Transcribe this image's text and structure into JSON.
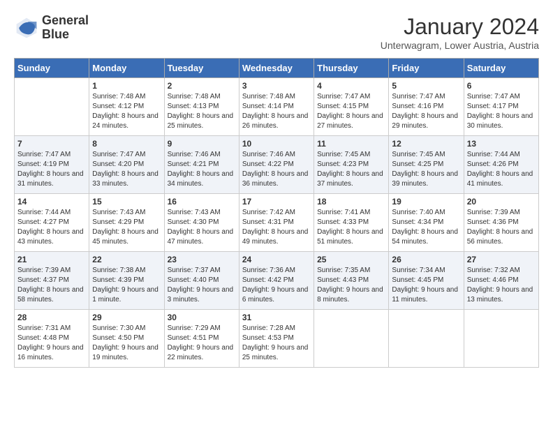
{
  "header": {
    "logo_line1": "General",
    "logo_line2": "Blue",
    "month": "January 2024",
    "location": "Unterwagram, Lower Austria, Austria"
  },
  "days_of_week": [
    "Sunday",
    "Monday",
    "Tuesday",
    "Wednesday",
    "Thursday",
    "Friday",
    "Saturday"
  ],
  "weeks": [
    [
      {
        "day": "",
        "sunrise": "",
        "sunset": "",
        "daylight": ""
      },
      {
        "day": "1",
        "sunrise": "7:48 AM",
        "sunset": "4:12 PM",
        "daylight": "8 hours and 24 minutes."
      },
      {
        "day": "2",
        "sunrise": "7:48 AM",
        "sunset": "4:13 PM",
        "daylight": "8 hours and 25 minutes."
      },
      {
        "day": "3",
        "sunrise": "7:48 AM",
        "sunset": "4:14 PM",
        "daylight": "8 hours and 26 minutes."
      },
      {
        "day": "4",
        "sunrise": "7:47 AM",
        "sunset": "4:15 PM",
        "daylight": "8 hours and 27 minutes."
      },
      {
        "day": "5",
        "sunrise": "7:47 AM",
        "sunset": "4:16 PM",
        "daylight": "8 hours and 29 minutes."
      },
      {
        "day": "6",
        "sunrise": "7:47 AM",
        "sunset": "4:17 PM",
        "daylight": "8 hours and 30 minutes."
      }
    ],
    [
      {
        "day": "7",
        "sunrise": "7:47 AM",
        "sunset": "4:19 PM",
        "daylight": "8 hours and 31 minutes."
      },
      {
        "day": "8",
        "sunrise": "7:47 AM",
        "sunset": "4:20 PM",
        "daylight": "8 hours and 33 minutes."
      },
      {
        "day": "9",
        "sunrise": "7:46 AM",
        "sunset": "4:21 PM",
        "daylight": "8 hours and 34 minutes."
      },
      {
        "day": "10",
        "sunrise": "7:46 AM",
        "sunset": "4:22 PM",
        "daylight": "8 hours and 36 minutes."
      },
      {
        "day": "11",
        "sunrise": "7:45 AM",
        "sunset": "4:23 PM",
        "daylight": "8 hours and 37 minutes."
      },
      {
        "day": "12",
        "sunrise": "7:45 AM",
        "sunset": "4:25 PM",
        "daylight": "8 hours and 39 minutes."
      },
      {
        "day": "13",
        "sunrise": "7:44 AM",
        "sunset": "4:26 PM",
        "daylight": "8 hours and 41 minutes."
      }
    ],
    [
      {
        "day": "14",
        "sunrise": "7:44 AM",
        "sunset": "4:27 PM",
        "daylight": "8 hours and 43 minutes."
      },
      {
        "day": "15",
        "sunrise": "7:43 AM",
        "sunset": "4:29 PM",
        "daylight": "8 hours and 45 minutes."
      },
      {
        "day": "16",
        "sunrise": "7:43 AM",
        "sunset": "4:30 PM",
        "daylight": "8 hours and 47 minutes."
      },
      {
        "day": "17",
        "sunrise": "7:42 AM",
        "sunset": "4:31 PM",
        "daylight": "8 hours and 49 minutes."
      },
      {
        "day": "18",
        "sunrise": "7:41 AM",
        "sunset": "4:33 PM",
        "daylight": "8 hours and 51 minutes."
      },
      {
        "day": "19",
        "sunrise": "7:40 AM",
        "sunset": "4:34 PM",
        "daylight": "8 hours and 54 minutes."
      },
      {
        "day": "20",
        "sunrise": "7:39 AM",
        "sunset": "4:36 PM",
        "daylight": "8 hours and 56 minutes."
      }
    ],
    [
      {
        "day": "21",
        "sunrise": "7:39 AM",
        "sunset": "4:37 PM",
        "daylight": "8 hours and 58 minutes."
      },
      {
        "day": "22",
        "sunrise": "7:38 AM",
        "sunset": "4:39 PM",
        "daylight": "9 hours and 1 minute."
      },
      {
        "day": "23",
        "sunrise": "7:37 AM",
        "sunset": "4:40 PM",
        "daylight": "9 hours and 3 minutes."
      },
      {
        "day": "24",
        "sunrise": "7:36 AM",
        "sunset": "4:42 PM",
        "daylight": "9 hours and 6 minutes."
      },
      {
        "day": "25",
        "sunrise": "7:35 AM",
        "sunset": "4:43 PM",
        "daylight": "9 hours and 8 minutes."
      },
      {
        "day": "26",
        "sunrise": "7:34 AM",
        "sunset": "4:45 PM",
        "daylight": "9 hours and 11 minutes."
      },
      {
        "day": "27",
        "sunrise": "7:32 AM",
        "sunset": "4:46 PM",
        "daylight": "9 hours and 13 minutes."
      }
    ],
    [
      {
        "day": "28",
        "sunrise": "7:31 AM",
        "sunset": "4:48 PM",
        "daylight": "9 hours and 16 minutes."
      },
      {
        "day": "29",
        "sunrise": "7:30 AM",
        "sunset": "4:50 PM",
        "daylight": "9 hours and 19 minutes."
      },
      {
        "day": "30",
        "sunrise": "7:29 AM",
        "sunset": "4:51 PM",
        "daylight": "9 hours and 22 minutes."
      },
      {
        "day": "31",
        "sunrise": "7:28 AM",
        "sunset": "4:53 PM",
        "daylight": "9 hours and 25 minutes."
      },
      {
        "day": "",
        "sunrise": "",
        "sunset": "",
        "daylight": ""
      },
      {
        "day": "",
        "sunrise": "",
        "sunset": "",
        "daylight": ""
      },
      {
        "day": "",
        "sunrise": "",
        "sunset": "",
        "daylight": ""
      }
    ]
  ],
  "labels": {
    "sunrise": "Sunrise:",
    "sunset": "Sunset:",
    "daylight": "Daylight:"
  }
}
